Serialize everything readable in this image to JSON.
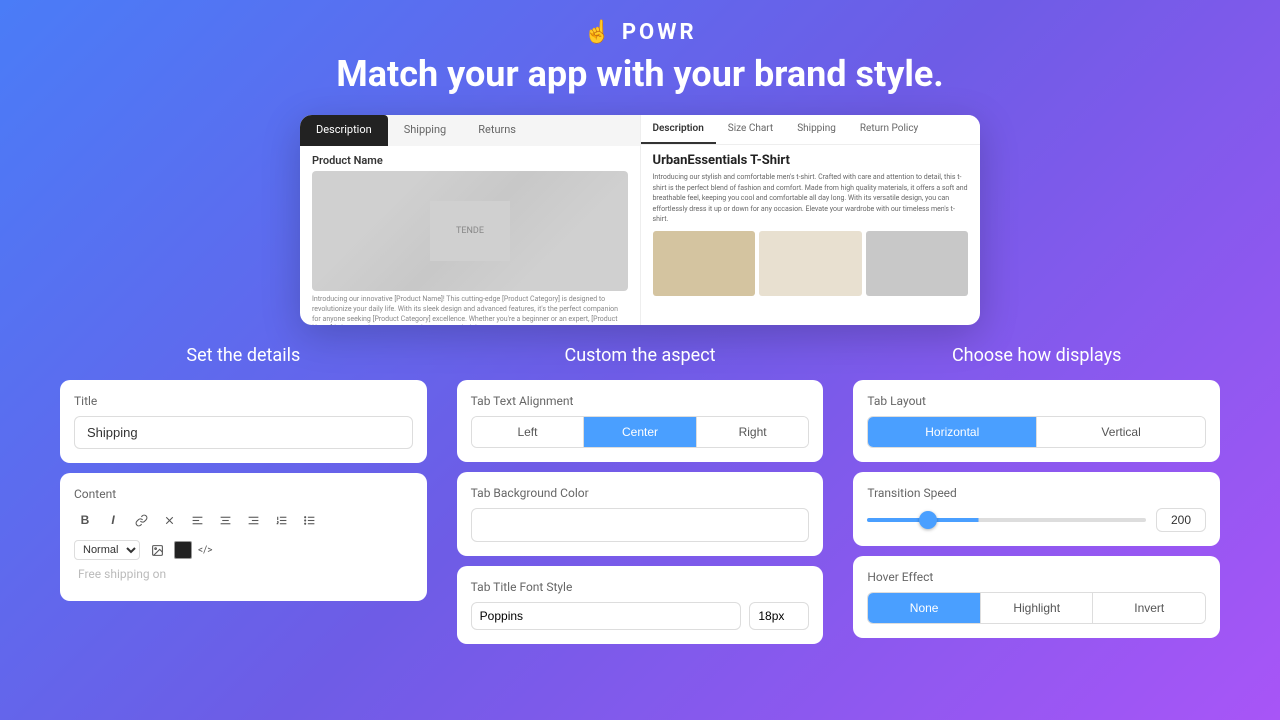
{
  "header": {
    "logo_text": "POWR",
    "logo_icon": "☝",
    "headline": "Match your app with your brand style."
  },
  "preview": {
    "left": {
      "tabs": [
        "Description",
        "Shipping",
        "Returns"
      ],
      "active_tab": "Description",
      "product_name": "Product Name",
      "desc_text": "Introducing our innovative [Product Name]! This cutting-edge [Product Category] is designed to revolutionize your daily life. With its sleek design and advanced features, it's the perfect companion for anyone seeking [Product Category] excellence. Whether you're a beginner or an expert, [Product Name] is here to elevate your experience to new heights."
    },
    "right": {
      "tabs": [
        "Description",
        "Size Chart",
        "Shipping",
        "Return Policy"
      ],
      "active_tab": "Description",
      "product_title": "UrbanEssentials T-Shirt",
      "product_desc": "Introducing our stylish and comfortable men's t-shirt. Crafted with care and attention to detail, this t-shirt is the perfect blend of fashion and comfort. Made from high quality materials, it offers a soft and breathable feel, keeping you cool and comfortable all day long. With its versatile design, you can effortlessly dress it up or down for any occasion. Elevate your wardrobe with our timeless men's t-shirt."
    }
  },
  "set_details": {
    "section_title": "Set the details",
    "title_label": "Title",
    "title_value": "Shipping",
    "content_label": "Content",
    "font_style_select": "Normal",
    "content_preview": "Free shipping on",
    "toolbar": {
      "bold": "B",
      "italic": "I",
      "link": "🔗",
      "clear": "⊘",
      "align_left": "≡",
      "align_center": "≡",
      "align_right": "≡",
      "ordered_list": "1.",
      "unordered_list": "•",
      "code": "<>"
    }
  },
  "custom_aspect": {
    "section_title": "Custom the aspect",
    "tab_text_alignment": {
      "label": "Tab Text Alignment",
      "options": [
        "Left",
        "Center",
        "Right"
      ],
      "active": "Center"
    },
    "tab_background_color": {
      "label": "Tab Background Color",
      "value": ""
    },
    "tab_title_font_style": {
      "label": "Tab Title Font Style",
      "font_family": "Poppins",
      "font_size": "18px"
    }
  },
  "choose_displays": {
    "section_title": "Choose how displays",
    "tab_layout": {
      "label": "Tab Layout",
      "options": [
        "Horizontal",
        "Vertical"
      ],
      "active": "Horizontal"
    },
    "transition_speed": {
      "label": "Transition Speed",
      "value": 200,
      "min": 0,
      "max": 1000
    },
    "hover_effect": {
      "label": "Hover Effect",
      "options": [
        "None",
        "Highlight",
        "Invert"
      ],
      "active": "None"
    }
  }
}
